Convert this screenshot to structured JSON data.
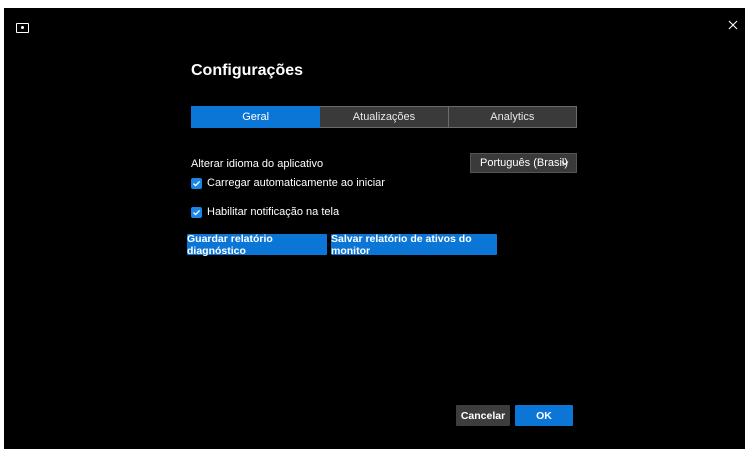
{
  "window": {
    "title": "Configurações",
    "icons": {
      "app": "display-icon",
      "close": "close-icon"
    }
  },
  "tabs": [
    {
      "label": "Geral",
      "active": true
    },
    {
      "label": "Atualizações",
      "active": false
    },
    {
      "label": "Analytics",
      "active": false
    }
  ],
  "settings": {
    "language_label": "Alterar idioma do aplicativo",
    "language_value": "Português (Brasil)",
    "autostart_label": "Carregar automaticamente ao iniciar",
    "autostart_checked": true,
    "notification_label": "Habilitar notificação na tela",
    "notification_checked": true
  },
  "actions": {
    "diagnostic_label": "Guardar relatório diagnóstico",
    "asset_report_label": "Salvar relatório de ativos do monitor"
  },
  "footer": {
    "cancel_label": "Cancelar",
    "ok_label": "OK"
  },
  "colors": {
    "accent": "#0b76d6",
    "background": "#000000",
    "tab_inactive": "#3a3a3a",
    "secondary_button": "#3d3d3d"
  }
}
